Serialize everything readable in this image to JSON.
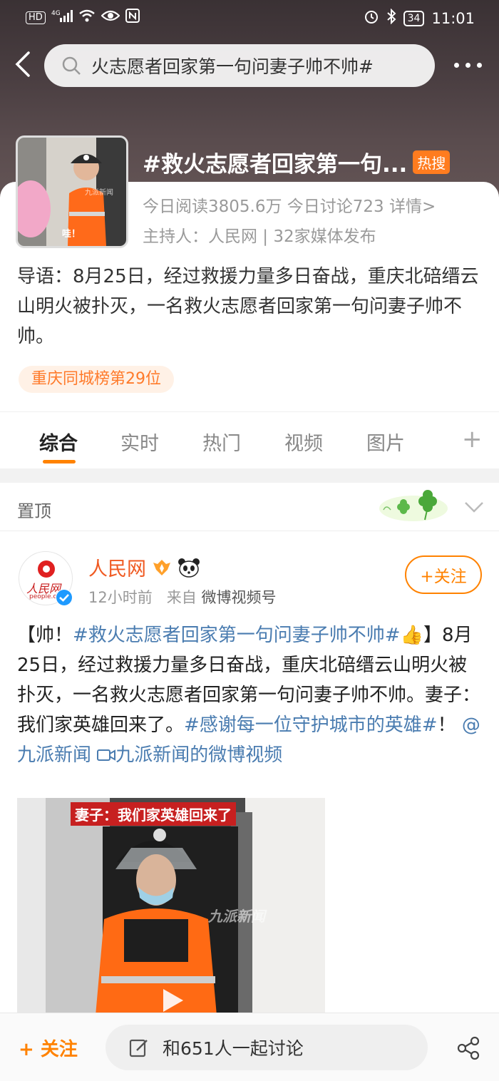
{
  "status_bar": {
    "left_icons": [
      "HD",
      "4G",
      "signal-icon",
      "wifi-icon",
      "eye-icon",
      "nfc-icon"
    ],
    "battery": "34",
    "time": "11:01"
  },
  "search": {
    "query": "火志愿者回家第一句问妻子帅不帅#"
  },
  "topic": {
    "title": "#救火志愿者回家第一句...",
    "hot_label": "热搜",
    "stats": "今日阅读3805.6万  今日讨论723  详情>",
    "host": "主持人：人民网 | 32家媒体发布",
    "thumb_caption": "哇！",
    "thumb_watermark": "九派新闻",
    "intro": "导语：8月25日，经过救援力量多日奋战，重庆北碚缙云山明火被扑灭，一名救火志愿者回家第一句问妻子帅不帅。",
    "rank": "重庆同城榜第29位"
  },
  "tabs": [
    {
      "label": "综合",
      "active": true
    },
    {
      "label": "实时",
      "active": false
    },
    {
      "label": "热门",
      "active": false
    },
    {
      "label": "视频",
      "active": false
    },
    {
      "label": "图片",
      "active": false
    }
  ],
  "tabs_plus": "+",
  "pinned": {
    "label": "置顶"
  },
  "post": {
    "author": "人民网",
    "avatar_text": "人民网",
    "avatar_sub": "people.cn",
    "time": "12小时前",
    "from_prefix": "来自",
    "source": "微博视频号",
    "follow_label": "+关注",
    "body_1": "【帅！",
    "body_tag1": "#救火志愿者回家第一句问妻子帅不帅#",
    "body_2": "👍】8月25日，经过救援力量多日奋战，重庆北碚缙云山明火被扑灭，一名救火志愿者回家第一句问妻子帅不帅。妻子：我们家英雄回来了。",
    "body_tag2": "#感谢每一位守护城市的英雄#",
    "body_3": "！",
    "body_mention": "@九派新闻",
    "body_video_link": "九派新闻的微博视频",
    "video_caption": "妻子：我们家英雄回来了",
    "video_watermark": "九派新闻"
  },
  "bottom_bar": {
    "follow_label": "+ 关注",
    "discuss_label": "和651人一起讨论"
  },
  "colors": {
    "accent": "#ff8200",
    "link": "#4a7cb0",
    "author": "#f05a22"
  }
}
